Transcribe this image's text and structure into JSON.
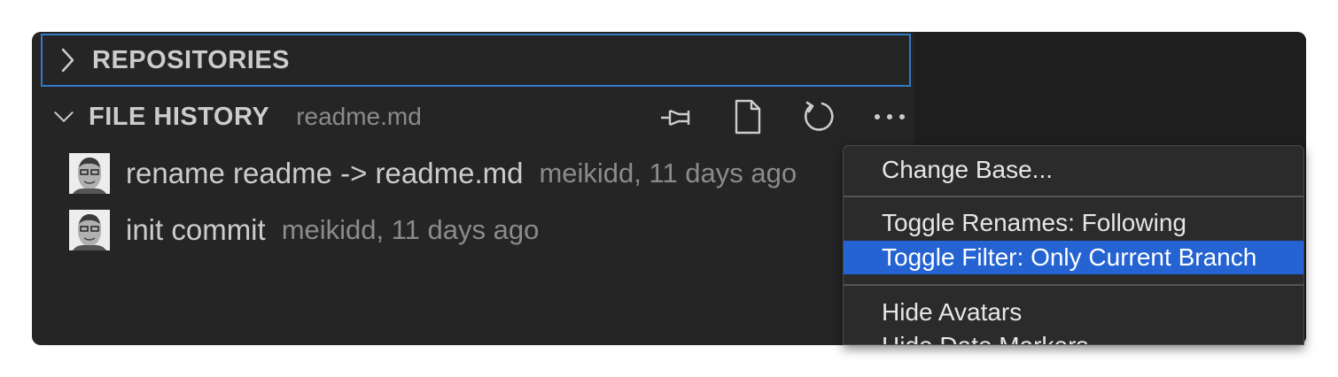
{
  "repositories": {
    "title": "REPOSITORIES",
    "collapsed": true
  },
  "file_history": {
    "title": "FILE HISTORY",
    "subtitle": "readme.md",
    "actions": [
      {
        "icon": "pin-icon"
      },
      {
        "icon": "file-icon"
      },
      {
        "icon": "refresh-icon"
      },
      {
        "icon": "more-icon"
      }
    ],
    "commits": [
      {
        "message": "rename readme -> readme.md",
        "meta": "meikidd, 11 days ago"
      },
      {
        "message": "init commit",
        "meta": "meikidd, 11 days ago"
      }
    ]
  },
  "menu": {
    "items": [
      {
        "label": "Change Base..."
      },
      {
        "label": "Toggle Renames: Following"
      },
      {
        "label": "Toggle Filter: Only Current Branch",
        "active": true
      },
      {
        "label": "Hide Avatars"
      },
      {
        "label": "Hide Date Markers"
      }
    ]
  },
  "colors": {
    "panel_bg": "#252526",
    "focus_border": "#3478c6",
    "menu_highlight": "#2463d1",
    "text": "#cccccc",
    "muted_text": "#8b8b8b"
  }
}
